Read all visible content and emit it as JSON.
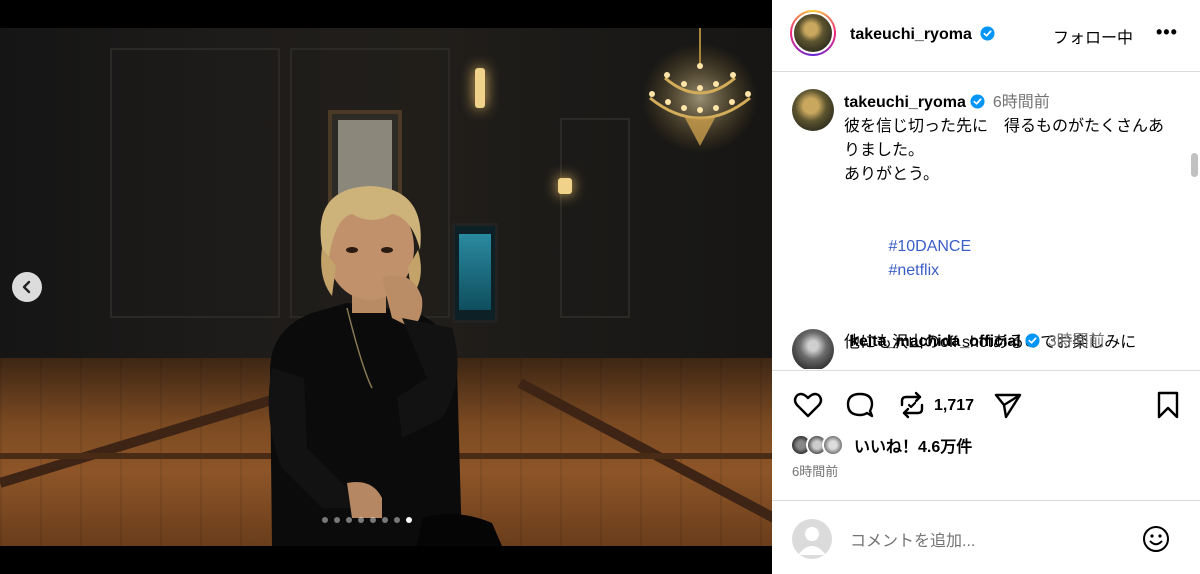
{
  "post": {
    "carousel": {
      "dot_count": 8,
      "active_index": 7
    }
  },
  "header": {
    "username": "takeuchi_ryoma",
    "follow_label": "フォロー中",
    "more_label": "•••"
  },
  "caption": {
    "username": "takeuchi_ryoma",
    "time": "6時間前",
    "line1": "彼を信じ切った先に　得るものがたくさんありました。",
    "line2": "ありがとう。",
    "hashtags": [
      "#10DANCE",
      "#netflix"
    ],
    "line3": "他にも沢山のoff shotあるのでお楽しみに"
  },
  "comment2": {
    "username": "keita_machida_official",
    "time": "3時間前"
  },
  "actions": {
    "repost_count": "1,717",
    "likes_text": "いいね！4.6万件",
    "posted_time": "6時間前"
  },
  "comment_input": {
    "placeholder": "コメントを追加..."
  },
  "colors": {
    "verified": "#0095f6",
    "link": "#3b5ec7",
    "border": "#dbdbdb",
    "muted": "#737373"
  }
}
